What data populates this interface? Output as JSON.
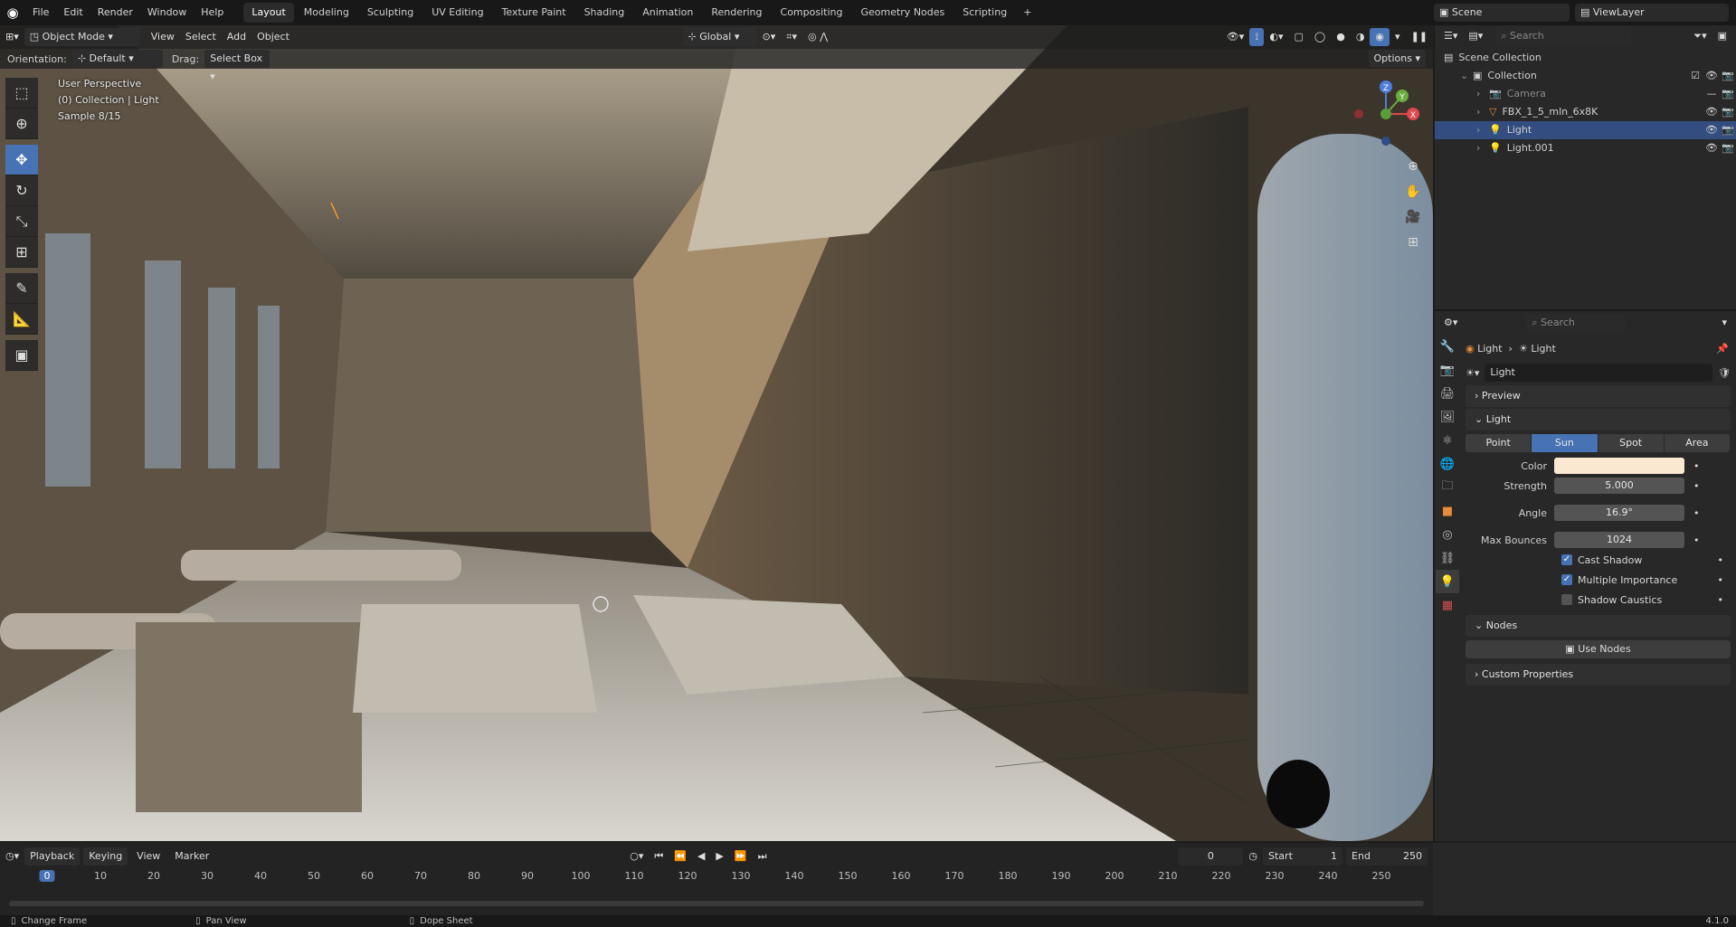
{
  "app": {
    "logo_icon": "blender-logo-icon",
    "version": "4.1.0"
  },
  "menus": [
    "File",
    "Edit",
    "Render",
    "Window",
    "Help"
  ],
  "workspaces": [
    {
      "label": "Layout",
      "active": true
    },
    {
      "label": "Modeling"
    },
    {
      "label": "Sculpting"
    },
    {
      "label": "UV Editing"
    },
    {
      "label": "Texture Paint"
    },
    {
      "label": "Shading"
    },
    {
      "label": "Animation"
    },
    {
      "label": "Rendering"
    },
    {
      "label": "Compositing"
    },
    {
      "label": "Geometry Nodes"
    },
    {
      "label": "Scripting"
    }
  ],
  "add_workspace": "+",
  "scene": {
    "label": "Scene",
    "viewlayer": "ViewLayer"
  },
  "viewport": {
    "mode": "Object Mode",
    "menus": [
      "View",
      "Select",
      "Add",
      "Object"
    ],
    "transform": "Global",
    "orientation_label": "Orientation:",
    "orientation_value": "Default",
    "drag_label": "Drag:",
    "drag_value": "Select Box",
    "options": "Options",
    "info": [
      "User Perspective",
      "(0) Collection | Light",
      "Sample 8/15"
    ],
    "gizmo": {
      "x": "X",
      "y": "Y",
      "z": "Z"
    }
  },
  "outliner": {
    "search_placeholder": "Search",
    "rows": [
      {
        "label": "Scene Collection",
        "indent": 0,
        "icon": "scene-collection-icon"
      },
      {
        "label": "Collection",
        "indent": 1,
        "icon": "collection-icon"
      },
      {
        "label": "Camera",
        "indent": 2,
        "icon": "camera-icon",
        "dim": true
      },
      {
        "label": "FBX_1_5_mln_6x8K",
        "indent": 2,
        "icon": "mesh-icon"
      },
      {
        "label": "Light",
        "indent": 2,
        "icon": "light-icon",
        "selected": true
      },
      {
        "label": "Light.001",
        "indent": 2,
        "icon": "light-icon"
      }
    ]
  },
  "properties": {
    "search_placeholder": "Search",
    "breadcrumb": [
      "Light",
      "Light"
    ],
    "datablock": "Light",
    "panels": {
      "preview": "Preview",
      "light": "Light",
      "nodes": "Nodes",
      "custom": "Custom Properties"
    },
    "light_types": [
      {
        "label": "Point"
      },
      {
        "label": "Sun",
        "active": true
      },
      {
        "label": "Spot"
      },
      {
        "label": "Area"
      }
    ],
    "fields": [
      {
        "label": "Color",
        "value": ""
      },
      {
        "label": "Strength",
        "value": "5.000"
      },
      {
        "label": "Angle",
        "value": "16.9°"
      },
      {
        "label": "Max Bounces",
        "value": "1024"
      }
    ],
    "checks": [
      {
        "label": "Cast Shadow",
        "checked": true
      },
      {
        "label": "Multiple Importance",
        "checked": true
      },
      {
        "label": "Shadow Caustics",
        "checked": false
      }
    ],
    "use_nodes": "Use Nodes",
    "light_color": "#fbe8d0"
  },
  "timeline": {
    "menus": [
      "Playback",
      "Keying",
      "View",
      "Marker"
    ],
    "current_frame": "0",
    "start_label": "Start",
    "start": "1",
    "end_label": "End",
    "end": "250",
    "ticks": [
      "0",
      "10",
      "20",
      "30",
      "40",
      "50",
      "60",
      "70",
      "80",
      "90",
      "100",
      "110",
      "120",
      "130",
      "140",
      "150",
      "160",
      "170",
      "180",
      "190",
      "200",
      "210",
      "220",
      "230",
      "240",
      "250"
    ]
  },
  "status": [
    "Change Frame",
    "Pan View",
    "Dope Sheet"
  ],
  "colors": {
    "accent": "#4772b3",
    "selected_row": "#334d80",
    "frame_marker": "#4772b3"
  }
}
